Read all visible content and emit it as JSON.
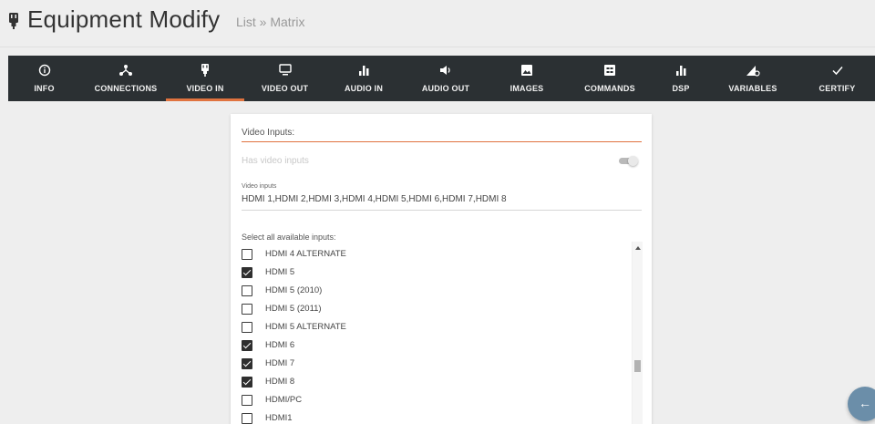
{
  "header": {
    "title": "Equipment Modify",
    "breadcrumb": "List » Matrix"
  },
  "tabs": [
    {
      "label": "INFO",
      "icon": "info-icon"
    },
    {
      "label": "CONNECTIONS",
      "icon": "connections-icon"
    },
    {
      "label": "VIDEO IN",
      "icon": "plug-icon",
      "active": true
    },
    {
      "label": "VIDEO OUT",
      "icon": "monitor-icon"
    },
    {
      "label": "AUDIO IN",
      "icon": "bars-icon"
    },
    {
      "label": "AUDIO OUT",
      "icon": "speaker-icon"
    },
    {
      "label": "IMAGES",
      "icon": "image-icon"
    },
    {
      "label": "COMMANDS",
      "icon": "commands-icon"
    },
    {
      "label": "DSP",
      "icon": "bars-icon"
    },
    {
      "label": "VARIABLES",
      "icon": "variables-icon"
    },
    {
      "label": "CERTIFY",
      "icon": "check-icon"
    }
  ],
  "form": {
    "section_title": "Video Inputs:",
    "has_video_label": "Has video inputs",
    "has_video_enabled": true,
    "video_inputs_label": "Video inputs",
    "video_inputs_value": "HDMI 1,HDMI 2,HDMI 3,HDMI 4,HDMI 5,HDMI 6,HDMI 7,HDMI 8",
    "select_label": "Select all available inputs:",
    "options": [
      {
        "label": "HDMI 4 ALTERNATE",
        "checked": false
      },
      {
        "label": "HDMI 5",
        "checked": true
      },
      {
        "label": "HDMI 5 (2010)",
        "checked": false
      },
      {
        "label": "HDMI 5 (2011)",
        "checked": false
      },
      {
        "label": "HDMI 5 ALTERNATE",
        "checked": false
      },
      {
        "label": "HDMI 6",
        "checked": true
      },
      {
        "label": "HDMI 7",
        "checked": true
      },
      {
        "label": "HDMI 8",
        "checked": true
      },
      {
        "label": "HDMI/PC",
        "checked": false
      },
      {
        "label": "HDMI1",
        "checked": false
      }
    ]
  },
  "fab": {
    "icon": "back-arrow-icon",
    "glyph": "←"
  },
  "colors": {
    "accent": "#e0733f",
    "tabbar": "#2b3033",
    "fab": "#6b8ea9"
  }
}
